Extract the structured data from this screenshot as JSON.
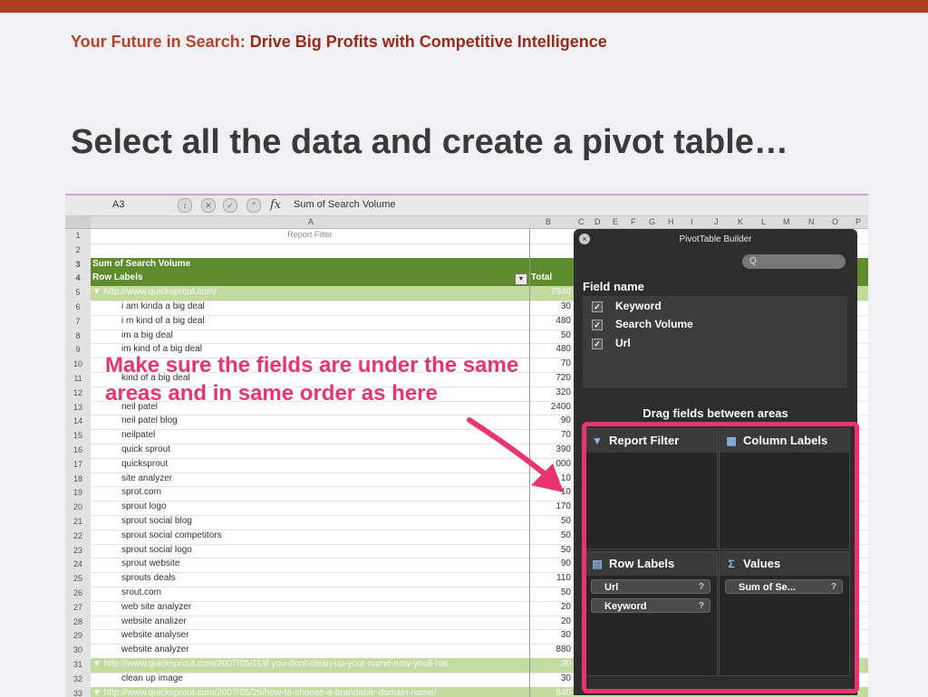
{
  "slide": {
    "header_prefix": "Your Future in Search:",
    "header_suffix": "Drive Big Profits with Competitive Intelligence",
    "title": "Select all the data and create a pivot table…"
  },
  "formula_bar": {
    "name_box": "A3",
    "fx": "fx",
    "value": "Sum of Search Volume"
  },
  "columns": [
    "A",
    "B",
    "C",
    "D",
    "E",
    "F",
    "G",
    "H",
    "I",
    "J",
    "K",
    "L",
    "M",
    "N",
    "O",
    "P"
  ],
  "sheet": {
    "report_filter": "Report Filter",
    "rows": [
      {
        "n": "1",
        "a": "",
        "b": ""
      },
      {
        "n": "2",
        "a": "",
        "b": ""
      },
      {
        "n": "3",
        "a": "Sum of Search Volume",
        "b": ""
      },
      {
        "n": "4",
        "a": "Row Labels",
        "b": "Total"
      },
      {
        "n": "5",
        "a": "▼ http://www.quicksprout.com/",
        "b": "7940"
      },
      {
        "n": "6",
        "a": "i am kinda a big deal",
        "b": "30"
      },
      {
        "n": "7",
        "a": "i m kind of a big deal",
        "b": "480"
      },
      {
        "n": "8",
        "a": "im a big deal",
        "b": "50"
      },
      {
        "n": "9",
        "a": "im kind of a big deal",
        "b": "480"
      },
      {
        "n": "10",
        "a": "",
        "b": "70"
      },
      {
        "n": "11",
        "a": "kind of a big deal",
        "b": "720"
      },
      {
        "n": "12",
        "a": "",
        "b": "320"
      },
      {
        "n": "13",
        "a": "neil patel",
        "b": "2400"
      },
      {
        "n": "14",
        "a": "neil patel blog",
        "b": "90"
      },
      {
        "n": "15",
        "a": "neilpatel",
        "b": "70"
      },
      {
        "n": "16",
        "a": "quick sprout",
        "b": "390"
      },
      {
        "n": "17",
        "a": "quicksprout",
        "b": "000"
      },
      {
        "n": "18",
        "a": "site analyzer",
        "b": "10"
      },
      {
        "n": "19",
        "a": "sprot.com",
        "b": "10"
      },
      {
        "n": "20",
        "a": "sprout logo",
        "b": "170"
      },
      {
        "n": "21",
        "a": "sprout social blog",
        "b": "50"
      },
      {
        "n": "22",
        "a": "sprout social competitors",
        "b": "50"
      },
      {
        "n": "23",
        "a": "sprout social logo",
        "b": "50"
      },
      {
        "n": "24",
        "a": "sprout website",
        "b": "90"
      },
      {
        "n": "25",
        "a": "sprouts deals",
        "b": "110"
      },
      {
        "n": "26",
        "a": "srout.com",
        "b": "50"
      },
      {
        "n": "27",
        "a": "web site analyzer",
        "b": "20"
      },
      {
        "n": "28",
        "a": "website analizer",
        "b": "20"
      },
      {
        "n": "29",
        "a": "website analyser",
        "b": "30"
      },
      {
        "n": "30",
        "a": "website analyzer",
        "b": "880"
      },
      {
        "n": "31",
        "a": "▼ http://www.quicksprout.com/2007/05/11/if-you-dont-clean-up-your-name-now-youll-hat",
        "b": "30"
      },
      {
        "n": "32",
        "a": "clean up image",
        "b": "30"
      },
      {
        "n": "33",
        "a": "▼ http://www.quicksprout.com/2007/05/29/how-to-choose-a-brandable-domain-name/",
        "b": "840"
      }
    ]
  },
  "annotation": {
    "line1": "Make sure the fields are under the same",
    "line2": "areas and in same order as here"
  },
  "pivot_builder": {
    "title": "PivotTable Builder",
    "search_placeholder": "Q",
    "field_name_label": "Field name",
    "fields": [
      "Keyword",
      "Search Volume",
      "Url"
    ],
    "drag_hint": "Drag fields between areas",
    "areas": {
      "report_filter": "Report Filter",
      "column_labels": "Column Labels",
      "row_labels": "Row Labels",
      "values": "Values"
    },
    "row_items": [
      "Url",
      "Keyword"
    ],
    "value_items": [
      "Sum of Se..."
    ]
  },
  "colors": {
    "accent": "#b03d22",
    "highlight": "#e8356f",
    "pivot_header_green": "#5e8b2c"
  }
}
